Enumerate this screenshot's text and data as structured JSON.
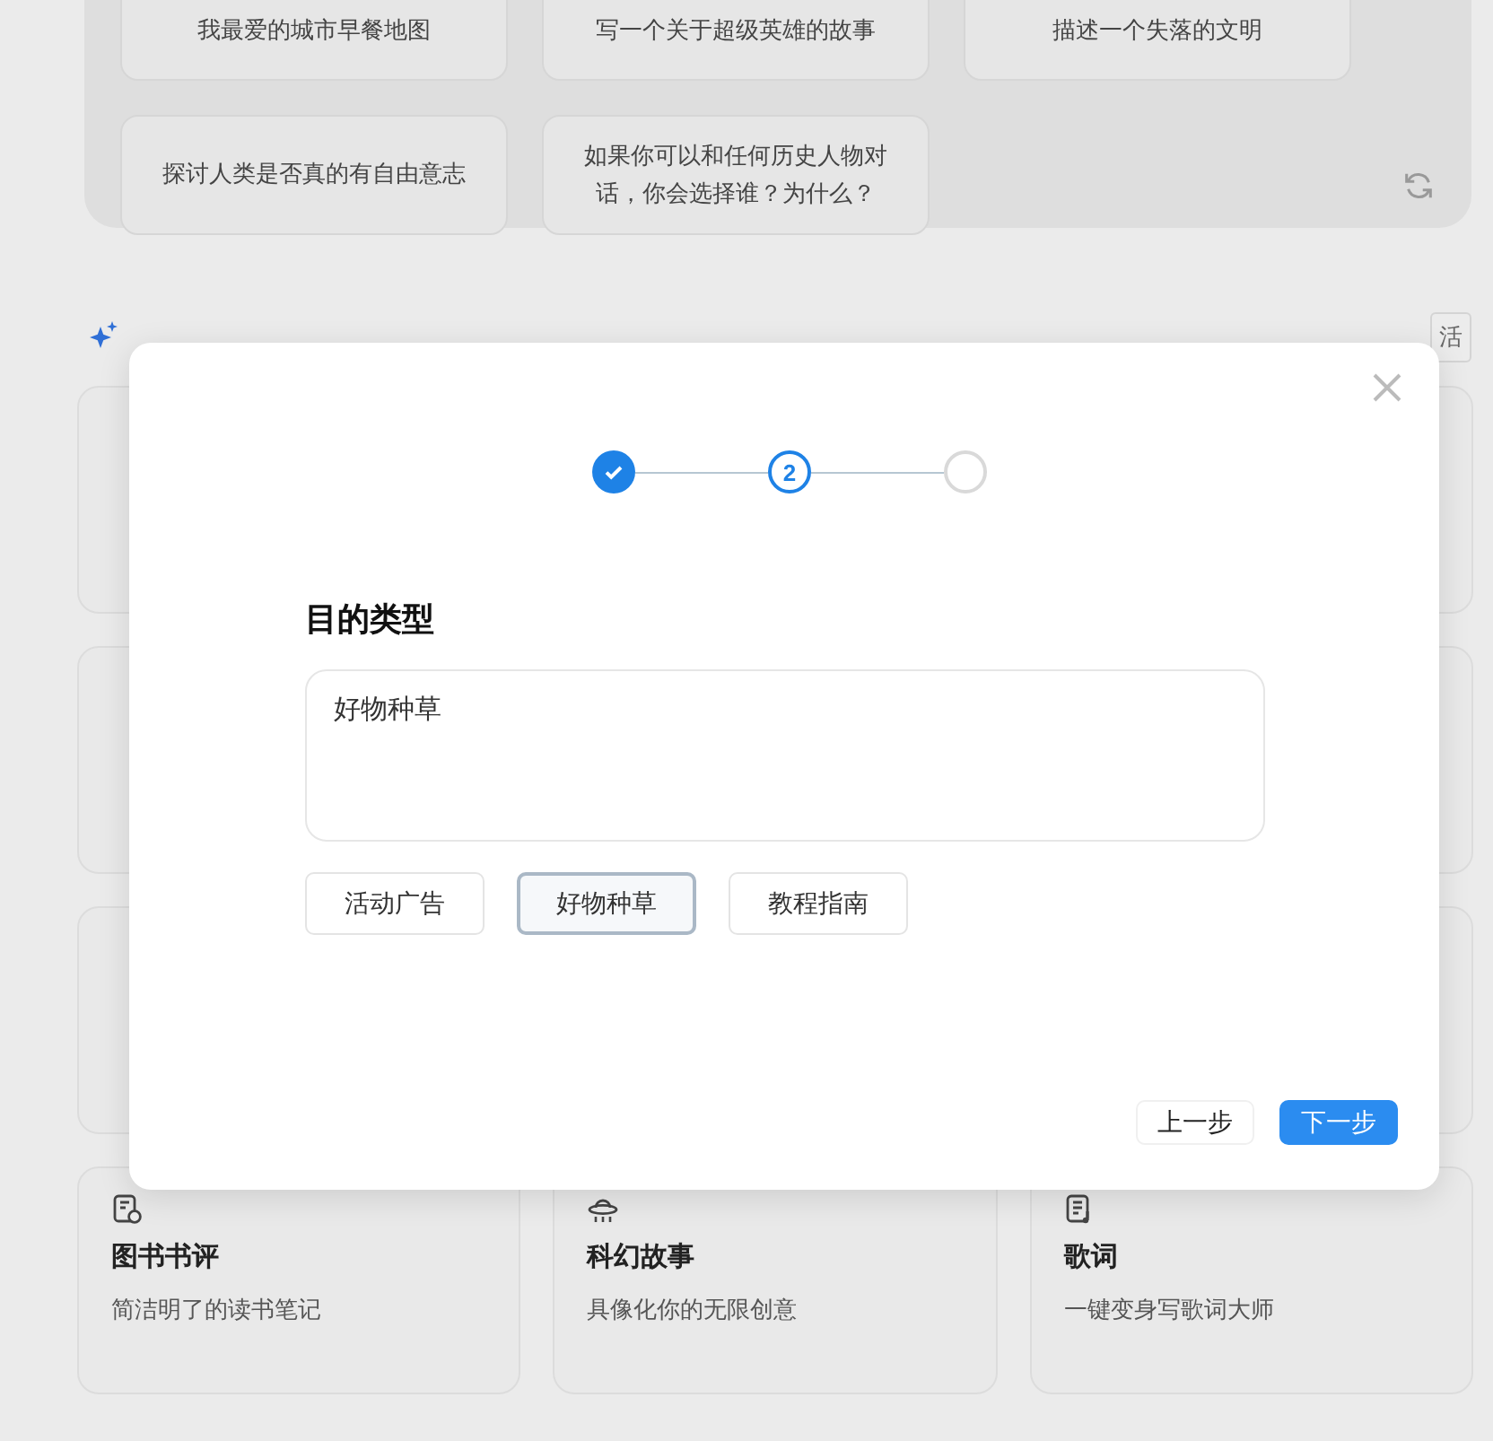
{
  "suggestions": {
    "chips": [
      {
        "text": "我最爱的城市早餐地图"
      },
      {
        "text": "写一个关于超级英雄的故事"
      },
      {
        "text": "描述一个失落的文明"
      },
      {
        "text": "探讨人类是否真的有自由意志"
      },
      {
        "text": "如果你可以和任何历史人物对话，你会选择谁？为什么？"
      }
    ]
  },
  "section": {
    "tag": "活"
  },
  "cards": [
    {
      "title": "图书书评",
      "desc_lines": [
        "简洁明了的读书笔记"
      ]
    },
    {
      "title": "科幻故事",
      "desc_lines": [
        "具像化你的无限创意"
      ]
    },
    {
      "title": "歌词",
      "desc_lines": [
        "一键变身写歌词大师"
      ]
    }
  ],
  "dialog": {
    "steps": [
      {
        "kind": "done"
      },
      {
        "kind": "current",
        "label": "2"
      },
      {
        "kind": "todo"
      }
    ],
    "title": "目的类型",
    "value": "好物种草",
    "options": [
      {
        "label": "活动广告",
        "selected": false
      },
      {
        "label": "好物种草",
        "selected": true
      },
      {
        "label": "教程指南",
        "selected": false
      }
    ],
    "back": "上一步",
    "next": "下一步"
  }
}
